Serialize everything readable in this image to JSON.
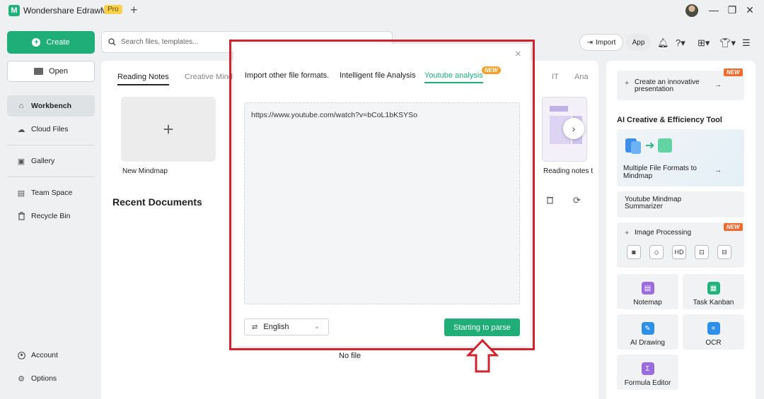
{
  "app": {
    "title": "Wondershare EdrawMind",
    "badge": "Pro",
    "logo_letter": "M"
  },
  "titlebar": {
    "add_tab": "+",
    "minimize": "—",
    "restore": "❐",
    "close": "✕"
  },
  "sidebar": {
    "create": "Create",
    "open": "Open",
    "items": [
      {
        "label": "Workbench",
        "icon": "home-icon",
        "glyph": "⌂"
      },
      {
        "label": "Cloud Files",
        "icon": "cloud-icon",
        "glyph": "☁"
      },
      {
        "label": "Gallery",
        "icon": "gallery-icon",
        "glyph": "▣"
      },
      {
        "label": "Team Space",
        "icon": "team-icon",
        "glyph": "▤"
      },
      {
        "label": "Recycle Bin",
        "icon": "trash-icon",
        "glyph": "🗑"
      }
    ],
    "account": "Account",
    "options": "Options"
  },
  "search": {
    "placeholder": "Search files, templates..."
  },
  "toolbar": {
    "import": "Import",
    "app": "App"
  },
  "main": {
    "tabs": [
      "Reading Notes",
      "Creative Mind",
      "IT",
      "Ana"
    ],
    "new_mindmap": "New Mindmap",
    "reading_notes_card": "Reading notes t",
    "recent_documents": "Recent Documents",
    "no_file": "No file"
  },
  "dialog": {
    "tabs": [
      "Import other file formats.",
      "Intelligent file Analysis",
      "Youtube analysis"
    ],
    "new_badge": "NEW",
    "url": "https://www.youtube.com/watch?v=bCoL1bKSYSo",
    "language": "English",
    "parse_button": "Starting to parse",
    "close": "×"
  },
  "right_panel": {
    "presentation": "Create an innovative presentation",
    "section_title": "AI Creative & Efficiency Tool",
    "multi_formats": "Multiple File Formats to Mindmap",
    "youtube_summarizer": "Youtube Mindmap Summarizer",
    "image_processing": "Image Processing",
    "new_badge": "NEW",
    "tools": [
      "Notemap",
      "Task Kanban",
      "AI Drawing",
      "OCR",
      "Formula Editor"
    ]
  },
  "colors": {
    "accent": "#1fae78",
    "highlight": "#d0232f",
    "new_badge": "#f26a2d"
  }
}
